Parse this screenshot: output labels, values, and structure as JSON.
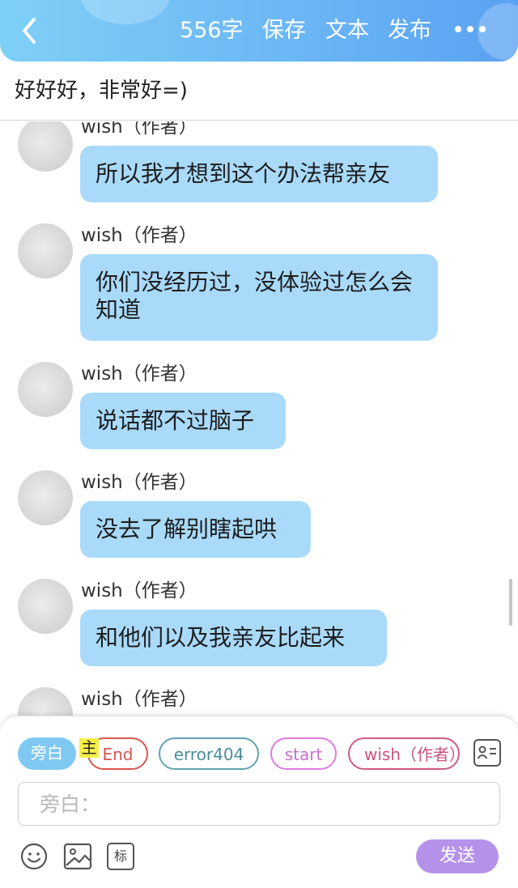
{
  "header": {
    "back_icon": "chevron-left-icon",
    "word_count": "556字",
    "save": "保存",
    "text": "文本",
    "publish": "发布",
    "more_icon": "more-dots-icon",
    "gradient": [
      "#7fd0f7",
      "#5aa2f2"
    ]
  },
  "story": {
    "title": "好好好，非常好=)"
  },
  "messages": [
    {
      "sender": "wish（作者）",
      "text": "所以我才想到这个办法帮亲友"
    },
    {
      "sender": "wish（作者）",
      "text": "你们没经历过，没体验过怎么会知道"
    },
    {
      "sender": "wish（作者）",
      "text": "说话都不过脑子"
    },
    {
      "sender": "wish（作者）",
      "text": "没去了解别瞎起哄"
    },
    {
      "sender": "wish（作者）",
      "text": "和他们以及我亲友比起来"
    },
    {
      "sender": "wish（作者）",
      "text": ""
    }
  ],
  "bubble_color": "#a9dafa",
  "roles": {
    "narration": "旁白",
    "main_tag": "主",
    "end": "End",
    "error404": "error404",
    "start": "start",
    "wish": "wish（作者）"
  },
  "input": {
    "placeholder": "旁白："
  },
  "toolbar": {
    "emoji_icon": "emoji-icon",
    "image_icon": "image-icon",
    "mark_label": "标",
    "send": "发送"
  },
  "accent_colors": {
    "send": "#b592ea",
    "narration": "#7fc8f1",
    "end": "#d9564f",
    "error404": "#61a3ae",
    "start": "#de7be0",
    "wish": "#d05a87",
    "main_tag": "#f5ee47"
  }
}
